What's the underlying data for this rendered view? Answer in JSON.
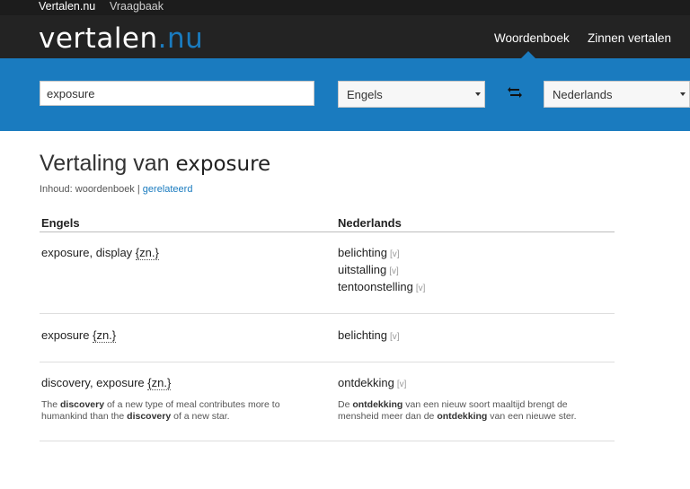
{
  "topbar": {
    "site": "Vertalen.nu",
    "help": "Vraagbaak"
  },
  "logo": {
    "main": "vertalen",
    "dot": ".",
    "tld": "nu"
  },
  "nav": {
    "dictionary": "Woordenboek",
    "sentences": "Zinnen vertalen"
  },
  "search": {
    "value": "exposure"
  },
  "languages": {
    "source": "Engels",
    "target": "Nederlands"
  },
  "title": {
    "prefix": "Vertaling van ",
    "word": "exposure"
  },
  "content": {
    "label": "Inhoud: woordenboek",
    "separator": "|",
    "related": "gerelateerd"
  },
  "columns": {
    "en": "Engels",
    "nl": "Nederlands"
  },
  "entries": [
    {
      "term": "exposure, display",
      "tag": "{zn.}",
      "translations": [
        {
          "word": "belichting",
          "v": "[v]"
        },
        {
          "word": "uitstalling",
          "v": "[v]"
        },
        {
          "word": "tentoonstelling",
          "v": "[v]"
        }
      ]
    },
    {
      "term": "exposure",
      "tag": "{zn.}",
      "translations": [
        {
          "word": "belichting",
          "v": "[v]"
        }
      ]
    },
    {
      "term": "discovery, exposure",
      "tag": "{zn.}",
      "translations": [
        {
          "word": "ontdekking",
          "v": "[v]"
        }
      ],
      "example_en": {
        "p1": "The ",
        "b1": "discovery",
        "p2": " of a new type of meal contributes more to humankind than the ",
        "b2": "discovery",
        "p3": " of a new star."
      },
      "example_nl": {
        "p1": "De ",
        "b1": "ontdekking",
        "p2": " van een nieuw soort maaltijd brengt de mensheid meer dan de ",
        "b2": "ontdekking",
        "p3": " van een nieuwe ster."
      }
    }
  ]
}
